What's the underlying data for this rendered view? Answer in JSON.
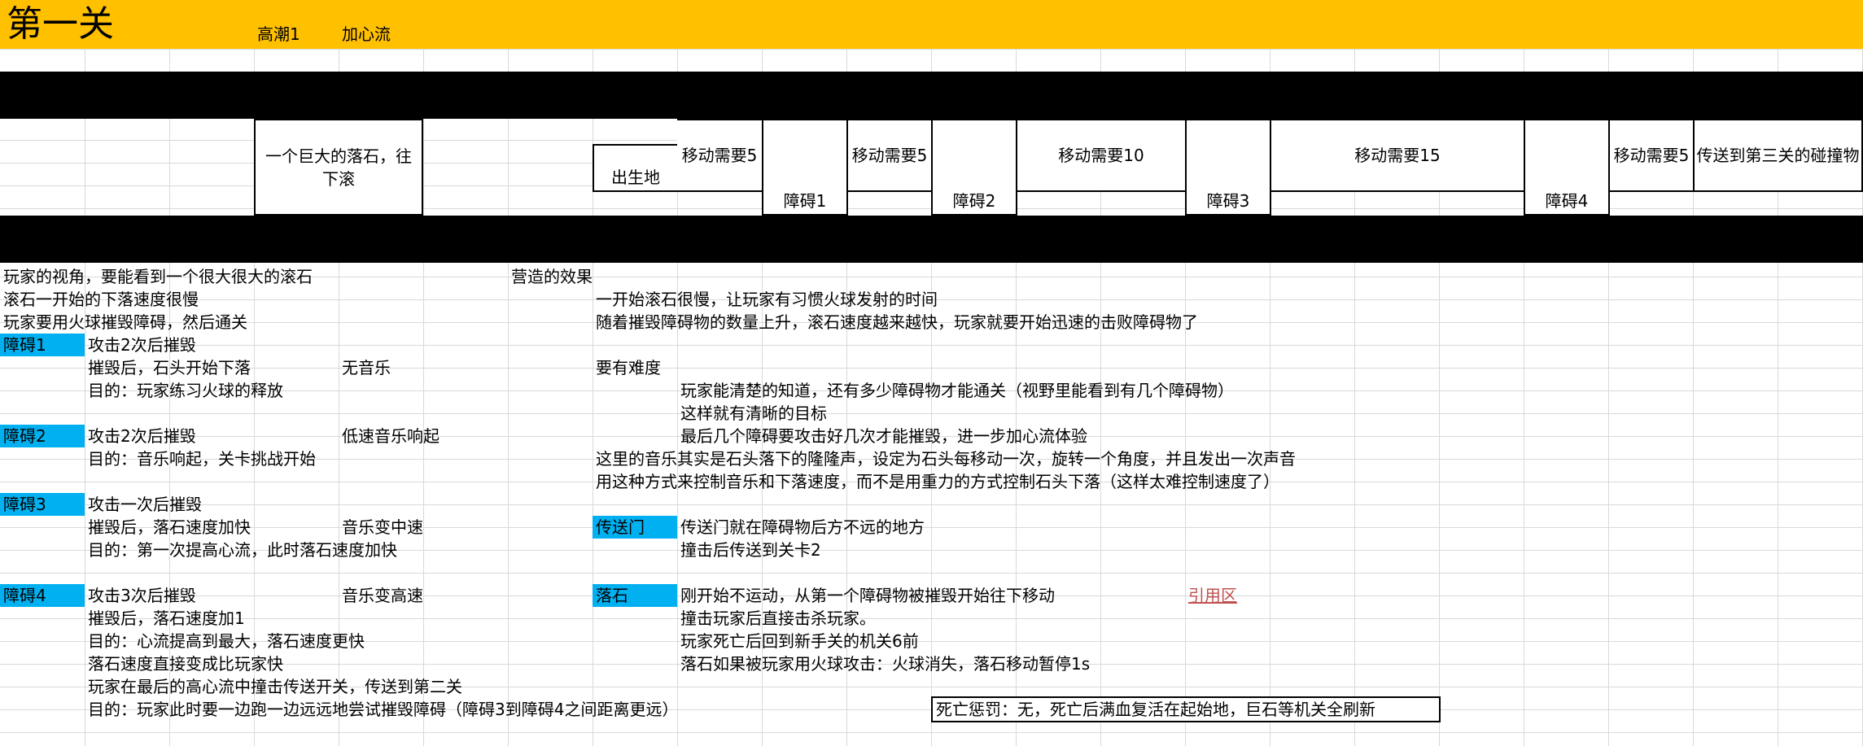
{
  "colors": {
    "header": "#FFC000",
    "band": "#000000",
    "tag": "#00B0F0",
    "link": "#C0504D"
  },
  "header": {
    "title": "第一关",
    "climax": "高潮1",
    "heart_flow": "加心流"
  },
  "level_boxes": {
    "rock": "一个巨大的落石，往下滚",
    "spawn": "出生地",
    "move1": "移动需要5",
    "obstacle1": "障碍1",
    "move2": "移动需要5",
    "obstacle2": "障碍2",
    "move3": "移动需要10",
    "obstacle3": "障碍3",
    "move4": "移动需要15",
    "obstacle4": "障碍4",
    "move5": "移动需要5",
    "teleport": "传送到第三关的碰撞物"
  },
  "notes": {
    "view": "玩家的视角，要能看到一个很大很大的滚石",
    "effect": "营造的效果",
    "slow": "滚石一开始的下落速度很慢",
    "slow_reason": "一开始滚石很慢，让玩家有习惯火球发射的时间",
    "destroy": "玩家要用火球摧毁障碍，然后通关",
    "speedup": "随着摧毁障碍物的数量上升，滚石速度越来越快，玩家就要开始迅速的击败障碍物了",
    "o1_tag": "障碍1",
    "o1_attack": "攻击2次后摧毁",
    "o1_after": "摧毁后，石头开始下落",
    "o1_music": "无音乐",
    "difficulty": "要有难度",
    "o1_goal": "目的：玩家练习火球的释放",
    "know": "玩家能清楚的知道，还有多少障碍物才能通关（视野里能看到有几个障碍物）",
    "clear_goal": "这样就有清晰的目标",
    "o2_tag": "障碍2",
    "o2_attack": "攻击2次后摧毁",
    "o2_music": "低速音乐响起",
    "last_few": "最后几个障碍要攻击好几次才能摧毁，进一步加心流体验",
    "o2_goal": "目的：音乐响起，关卡挑战开始",
    "music_is": "这里的音乐其实是石头落下的隆隆声，设定为石头每移动一次，旋转一个角度，并且发出一次声音",
    "music_control": "用这种方式来控制音乐和下落速度，而不是用重力的方式控制石头下落（这样太难控制速度了）",
    "o3_tag": "障碍3",
    "o3_attack": "攻击一次后摧毁",
    "o3_after": "摧毁后，落石速度加快",
    "o3_music": "音乐变中速",
    "portal_tag": "传送门",
    "portal_desc": "传送门就在障碍物后方不远的地方",
    "o3_goal": "目的：第一次提高心流，此时落石速度加快",
    "portal_hit": "撞击后传送到关卡2",
    "o4_tag": "障碍4",
    "o4_attack": "攻击3次后摧毁",
    "o4_music": "音乐变高速",
    "rock_tag": "落石",
    "rock_desc": "刚开始不运动，从第一个障碍物被摧毁开始往下移动",
    "ref_area": "引用区",
    "o4_after": "摧毁后，落石速度加1",
    "rock_kill": "撞击玩家后直接击杀玩家。",
    "o4_goal": "目的：心流提高到最大，落石速度更快",
    "respawn": "玩家死亡后回到新手关的机关6前",
    "faster": "落石速度直接变成比玩家快",
    "fireball": "落石如果被玩家用火球攻击：火球消失，落石移动暂停1s",
    "final_hit": "玩家在最后的高心流中撞击传送开关，传送到第二关",
    "final_goal": "目的：玩家此时要一边跑一边远远地尝试摧毁障碍（障碍3到障碍4之间距离更远）",
    "death": "死亡惩罚：无，死亡后满血复活在起始地，巨石等机关全刷新"
  }
}
